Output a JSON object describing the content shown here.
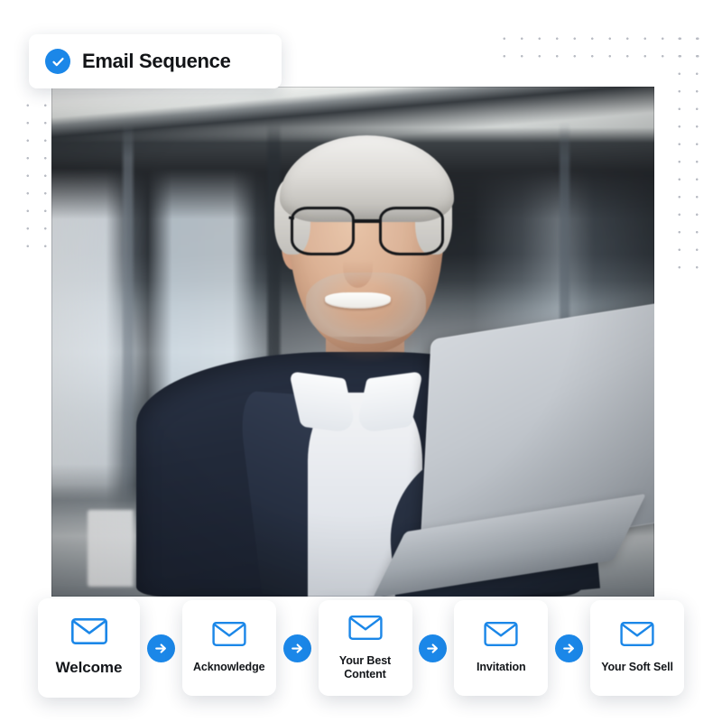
{
  "badge": {
    "title": "Email Sequence",
    "icon": "check-circle-icon"
  },
  "hero": {
    "alt": "Smiling businessman with glasses working on a laptop in an office"
  },
  "colors": {
    "accent_blue": "#1b87e8",
    "text_dark": "#13161a",
    "background": "#ffffff",
    "dot_grid": "#b9bcc4"
  },
  "sequence": {
    "connector_icon": "arrow-right-icon",
    "steps": [
      {
        "icon": "envelope-icon",
        "label": "Welcome",
        "size": "lg"
      },
      {
        "icon": "envelope-icon",
        "label": "Acknowledge",
        "size": "sm"
      },
      {
        "icon": "envelope-icon",
        "label": "Your Best Content",
        "size": "sm"
      },
      {
        "icon": "envelope-icon",
        "label": "Invitation",
        "size": "sm"
      },
      {
        "icon": "envelope-icon",
        "label": "Your Soft Sell",
        "size": "sm"
      }
    ]
  }
}
